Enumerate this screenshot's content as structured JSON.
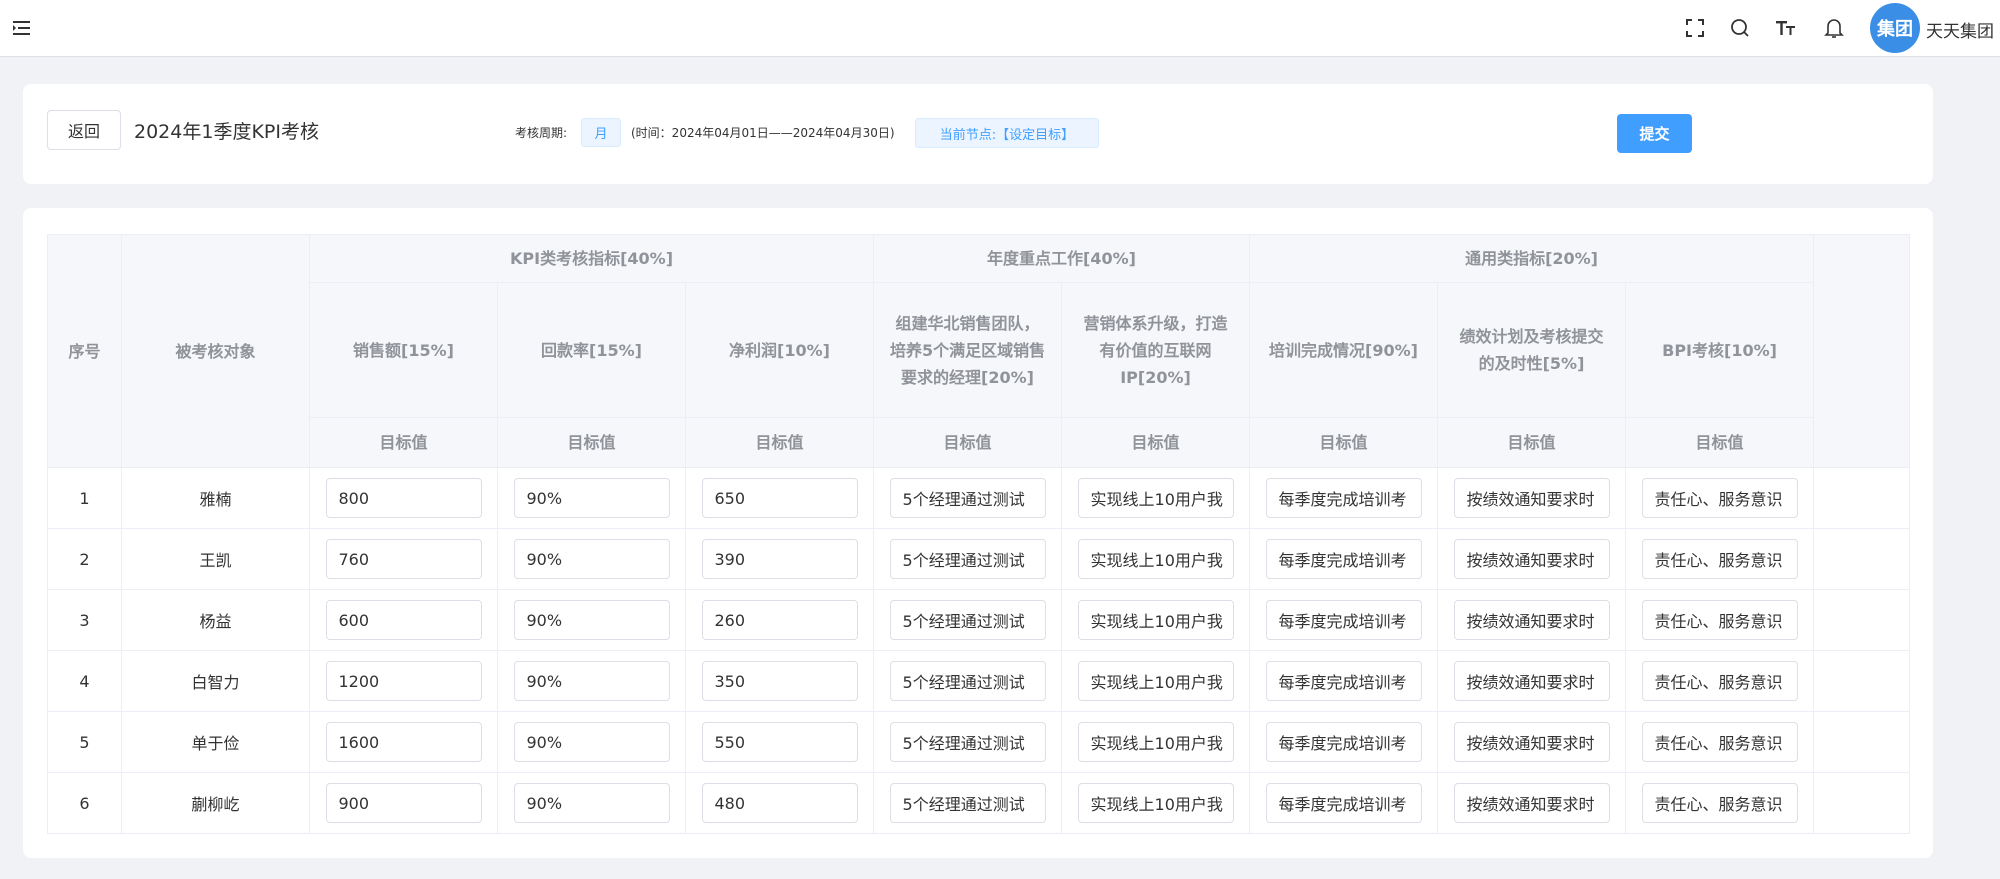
{
  "header": {
    "icons": [
      "menu-fold-icon",
      "fullscreen-icon",
      "search-icon",
      "font-size-icon",
      "bell-icon"
    ],
    "avatar_text": "集团",
    "username": "天天集团"
  },
  "info": {
    "back_label": "返回",
    "title": "2024年1季度KPI考核",
    "period_label": "考核周期:",
    "period_value": "月",
    "period_range": "(时间：2024年04月01日——2024年04月30日)",
    "current_node": "当前节点:【设定目标】",
    "submit_label": "提交"
  },
  "table": {
    "col_index": "序号",
    "col_target": "被考核对象",
    "groups": [
      "KPI类考核指标[40%]",
      "年度重点工作[40%]",
      "通用类指标[20%]"
    ],
    "indicators": [
      "销售额[15%]",
      "回款率[15%]",
      "净利润[10%]",
      "组建华北销售团队，培养5个满足区域销售要求的经理[20%]",
      "营销体系升级，打造有价值的互联网IP[20%]",
      "培训完成情况[90%]",
      "绩效计划及考核提交的及时性[5%]",
      "BPI考核[10%]"
    ],
    "target_label": "目标值",
    "rows": [
      {
        "index": "1",
        "name": "雅楠",
        "values": [
          "800",
          "90%",
          "650",
          "5个经理通过测试",
          "实现线上10用户我",
          "每季度完成培训考",
          "按绩效通知要求时",
          "责任心、服务意识"
        ]
      },
      {
        "index": "2",
        "name": "王凯",
        "values": [
          "760",
          "90%",
          "390",
          "5个经理通过测试",
          "实现线上10用户我",
          "每季度完成培训考",
          "按绩效通知要求时",
          "责任心、服务意识"
        ]
      },
      {
        "index": "3",
        "name": "杨益",
        "values": [
          "600",
          "90%",
          "260",
          "5个经理通过测试",
          "实现线上10用户我",
          "每季度完成培训考",
          "按绩效通知要求时",
          "责任心、服务意识"
        ]
      },
      {
        "index": "4",
        "name": "白智力",
        "values": [
          "1200",
          "90%",
          "350",
          "5个经理通过测试",
          "实现线上10用户我",
          "每季度完成培训考",
          "按绩效通知要求时",
          "责任心、服务意识"
        ]
      },
      {
        "index": "5",
        "name": "单于俭",
        "values": [
          "1600",
          "90%",
          "550",
          "5个经理通过测试",
          "实现线上10用户我",
          "每季度完成培训考",
          "按绩效通知要求时",
          "责任心、服务意识"
        ]
      },
      {
        "index": "6",
        "name": "蒯柳屹",
        "values": [
          "900",
          "90%",
          "480",
          "5个经理通过测试",
          "实现线上10用户我",
          "每季度完成培训考",
          "按绩效通知要求时",
          "责任心、服务意识"
        ]
      }
    ]
  }
}
